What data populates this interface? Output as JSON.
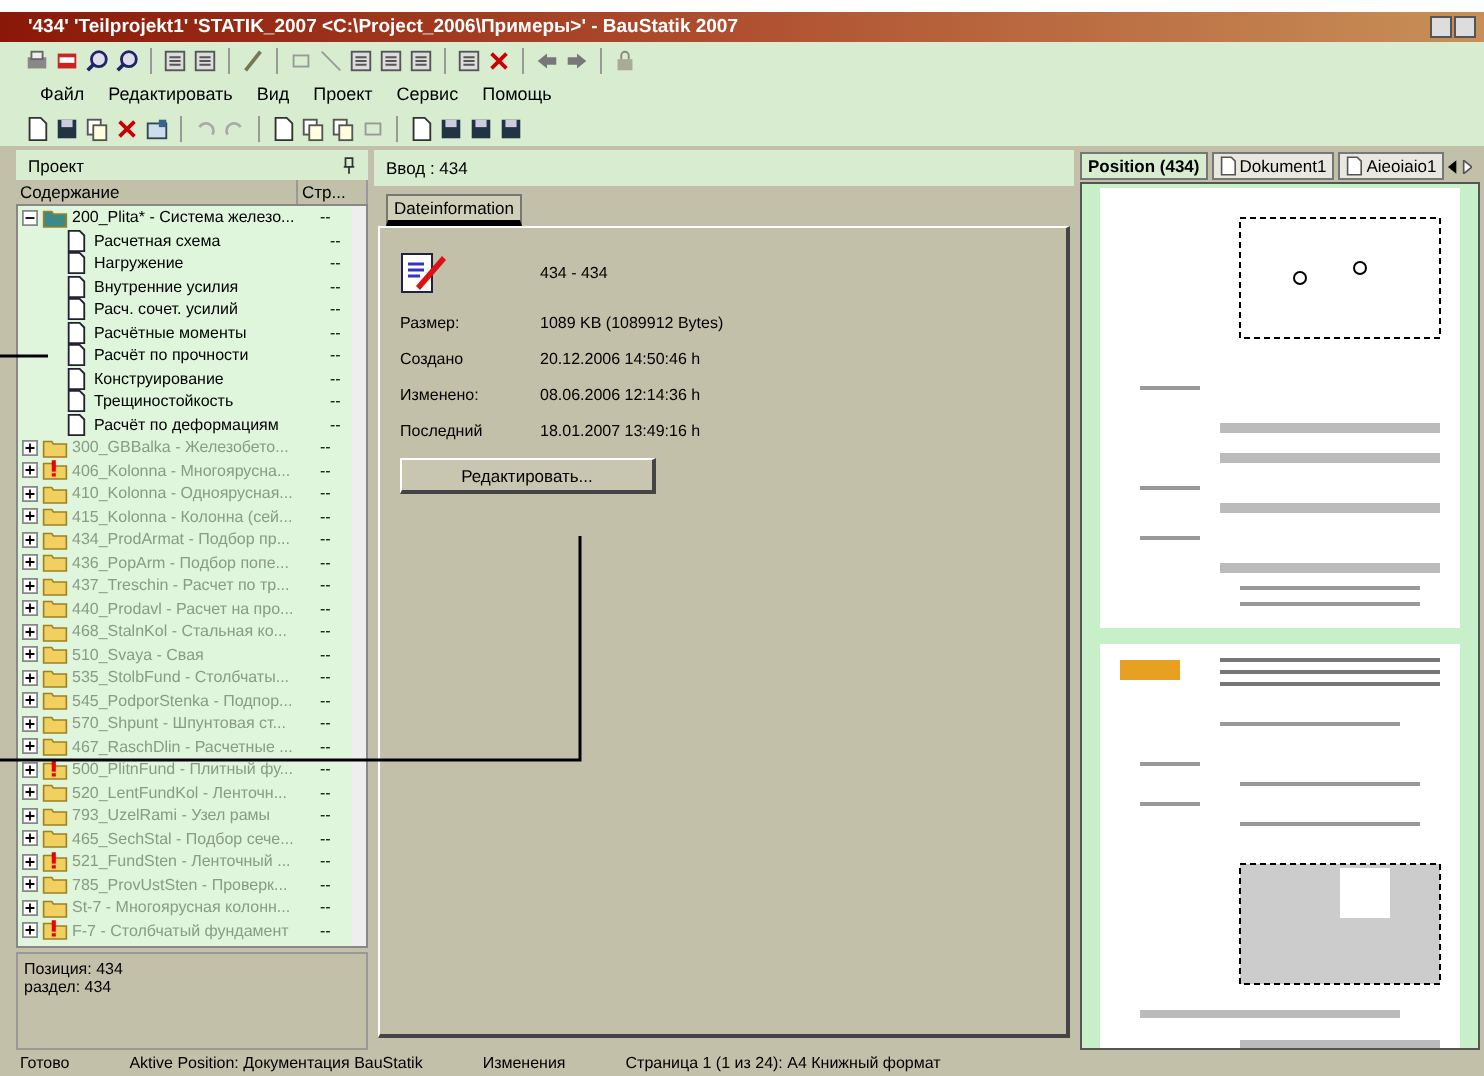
{
  "window": {
    "title": "'434' 'Teilprojekt1' 'STATIK_2007 <C:\\Project_2006\\Примеры>' - BauStatik 2007"
  },
  "menu": [
    "Файл",
    "Редактировать",
    "Вид",
    "Проект",
    "Сервис",
    "Помощь"
  ],
  "project_panel": {
    "title": "Проект",
    "columns": [
      "Содержание",
      "Стр..."
    ],
    "tree": [
      {
        "label": "200_Plita* - Система железо...",
        "pages": "--",
        "kind": "folder",
        "expanded": true,
        "warning": false,
        "disabled": false,
        "children": [
          {
            "label": "Расчетная схема",
            "pages": "--"
          },
          {
            "label": "Нагружение",
            "pages": "--"
          },
          {
            "label": "Внутренние усилия",
            "pages": "--"
          },
          {
            "label": "Расч. сочет. усилий",
            "pages": "--"
          },
          {
            "label": "Расчётные моменты",
            "pages": "--"
          },
          {
            "label": "Расчёт по прочности",
            "pages": "--"
          },
          {
            "label": "Конструирование",
            "pages": "--"
          },
          {
            "label": "Трещиностойкость",
            "pages": "--"
          },
          {
            "label": "Расчёт по деформациям",
            "pages": "--"
          }
        ]
      },
      {
        "label": "300_GBBalka - Железобето...",
        "pages": "--",
        "kind": "folder",
        "expanded": false,
        "warning": false,
        "disabled": true
      },
      {
        "label": "406_Kolonna - Многоярусна...",
        "pages": "--",
        "kind": "folder",
        "expanded": false,
        "warning": true,
        "disabled": true
      },
      {
        "label": "410_Kolonna - Одноярусная...",
        "pages": "--",
        "kind": "folder",
        "expanded": false,
        "warning": false,
        "disabled": true
      },
      {
        "label": "415_Kolonna - Колонна (сей...",
        "pages": "--",
        "kind": "folder",
        "expanded": false,
        "warning": false,
        "disabled": true
      },
      {
        "label": "434_ProdArmat - Подбор пр...",
        "pages": "--",
        "kind": "folder",
        "expanded": false,
        "warning": false,
        "disabled": true
      },
      {
        "label": "436_PopArm - Подбор попе...",
        "pages": "--",
        "kind": "folder",
        "expanded": false,
        "warning": false,
        "disabled": true
      },
      {
        "label": "437_Treschin - Расчет по тр...",
        "pages": "--",
        "kind": "folder",
        "expanded": false,
        "warning": false,
        "disabled": true
      },
      {
        "label": "440_Prodavl - Расчет на про...",
        "pages": "--",
        "kind": "folder",
        "expanded": false,
        "warning": false,
        "disabled": true
      },
      {
        "label": "468_StalnKol - Стальная ко...",
        "pages": "--",
        "kind": "folder",
        "expanded": false,
        "warning": false,
        "disabled": true
      },
      {
        "label": "510_Svaya - Свая",
        "pages": "--",
        "kind": "folder",
        "expanded": false,
        "warning": false,
        "disabled": true
      },
      {
        "label": "535_StolbFund - Столбчаты...",
        "pages": "--",
        "kind": "folder",
        "expanded": false,
        "warning": false,
        "disabled": true
      },
      {
        "label": "545_PodporStenka - Подпор...",
        "pages": "--",
        "kind": "folder",
        "expanded": false,
        "warning": false,
        "disabled": true
      },
      {
        "label": "570_Shpunt - Шпунтовая ст...",
        "pages": "--",
        "kind": "folder",
        "expanded": false,
        "warning": false,
        "disabled": true
      },
      {
        "label": "467_RaschDlin - Расчетные ...",
        "pages": "--",
        "kind": "folder",
        "expanded": false,
        "warning": false,
        "disabled": true
      },
      {
        "label": "500_PlitnFund - Плитный фу...",
        "pages": "--",
        "kind": "folder",
        "expanded": false,
        "warning": true,
        "disabled": true
      },
      {
        "label": "520_LentFundKol - Ленточн...",
        "pages": "--",
        "kind": "folder",
        "expanded": false,
        "warning": false,
        "disabled": true
      },
      {
        "label": "793_UzelRami - Узел рамы",
        "pages": "--",
        "kind": "folder",
        "expanded": false,
        "warning": false,
        "disabled": true
      },
      {
        "label": "465_SechStal - Подбор сече...",
        "pages": "--",
        "kind": "folder",
        "expanded": false,
        "warning": false,
        "disabled": true
      },
      {
        "label": "521_FundSten - Ленточный ...",
        "pages": "--",
        "kind": "folder",
        "expanded": false,
        "warning": true,
        "disabled": true
      },
      {
        "label": "785_ProvUstSten - Проверк...",
        "pages": "--",
        "kind": "folder",
        "expanded": false,
        "warning": false,
        "disabled": true
      },
      {
        "label": "St-7 - Многоярусная колонн...",
        "pages": "--",
        "kind": "folder",
        "expanded": false,
        "warning": false,
        "disabled": true
      },
      {
        "label": "F-7 - Столбчатый фундамент",
        "pages": "--",
        "kind": "folder",
        "expanded": false,
        "warning": true,
        "disabled": true
      }
    ],
    "info": [
      "Позиция: 434",
      "раздел: 434"
    ]
  },
  "input_panel": {
    "title": "Ввод : 434",
    "tabs": [
      {
        "label": "Dateinformation",
        "selected": true
      }
    ],
    "file_title": "434 - 434",
    "fields": [
      {
        "label": "Размер:",
        "value": "1089 KB (1089912 Bytes)"
      },
      {
        "label": "Создано",
        "value": "20.12.2006 14:50:46 h"
      },
      {
        "label": "Изменено:",
        "value": "08.06.2006 12:14:36 h"
      },
      {
        "label": "Последний",
        "value": "18.01.2007 13:49:16 h"
      }
    ],
    "edit_button": "Редактировать..."
  },
  "preview_panel": {
    "tabs": [
      {
        "label": "Position (434)",
        "selected": true,
        "kind": "plain"
      },
      {
        "label": "Dokument1",
        "selected": false,
        "kind": "document"
      },
      {
        "label": "Aieoiaio1",
        "selected": false,
        "kind": "document"
      }
    ]
  },
  "status_bar": [
    "Готово",
    "Aktive Position: Документация BauStatik",
    "Изменения",
    "Страница 1 (1 из 24): A4 Книжный формат"
  ]
}
